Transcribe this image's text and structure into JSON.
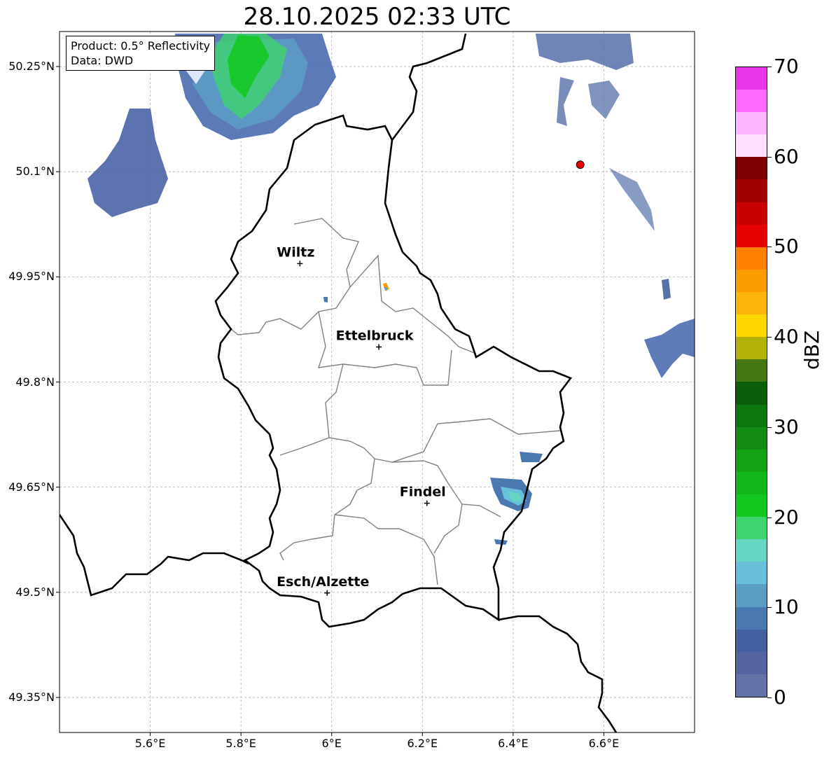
{
  "title": "28.10.2025 02:33 UTC",
  "info": {
    "product": "Product: 0.5° Reflectivity",
    "source": "Data: DWD"
  },
  "axes": {
    "lat_labels": [
      "50.25°N",
      "50.1°N",
      "49.95°N",
      "49.8°N",
      "49.65°N",
      "49.5°N",
      "49.35°N"
    ],
    "lat_values": [
      50.25,
      50.1,
      49.95,
      49.8,
      49.65,
      49.5,
      49.35
    ],
    "lon_labels": [
      "5.6°E",
      "5.8°E",
      "6°E",
      "6.2°E",
      "6.4°E",
      "6.6°E"
    ],
    "lon_values": [
      5.6,
      5.8,
      6.0,
      6.2,
      6.4,
      6.6
    ],
    "extent": {
      "lon_min": 5.4,
      "lon_max": 6.8,
      "lat_min": 49.3,
      "lat_max": 50.3
    }
  },
  "cities": [
    {
      "name": "Wiltz",
      "lon": 5.93,
      "lat": 49.969
    },
    {
      "name": "Ettelbruck",
      "lon": 6.104,
      "lat": 49.85
    },
    {
      "name": "Findel",
      "lon": 6.21,
      "lat": 49.627
    },
    {
      "name": "Esch/Alzette",
      "lon": 5.99,
      "lat": 49.499
    }
  ],
  "radar_site": {
    "lon": 6.548,
    "lat": 50.11,
    "color": "#e60000"
  },
  "colorbar": {
    "unit": "dBZ",
    "min": 0,
    "max": 70,
    "step": 2.5,
    "tick_labels": [
      "0",
      "10",
      "20",
      "30",
      "40",
      "50",
      "60",
      "70"
    ],
    "tick_values": [
      0,
      10,
      20,
      30,
      40,
      50,
      60,
      70
    ],
    "colors": [
      "#6373a7",
      "#5364a0",
      "#4360a0",
      "#4a78b0",
      "#5a9ec6",
      "#68c0da",
      "#64d6c2",
      "#3ed46e",
      "#12c81e",
      "#12b81a",
      "#12a412",
      "#128c12",
      "#0b780f",
      "#0a5e0a",
      "#457810",
      "#b2b208",
      "#ffd700",
      "#fdb50a",
      "#fd9c00",
      "#ff8000",
      "#e60000",
      "#c80000",
      "#a20000",
      "#7c0000",
      "#ffe0ff",
      "#ffb4ff",
      "#ff6cff",
      "#ea34ea"
    ]
  }
}
